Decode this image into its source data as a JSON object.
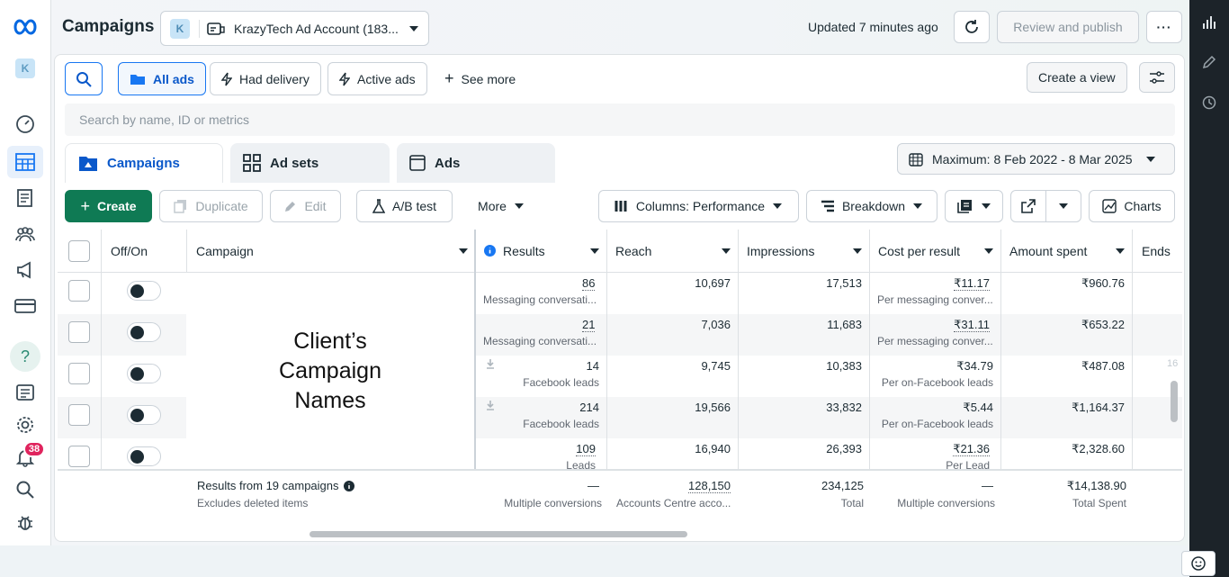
{
  "header": {
    "title": "Campaigns",
    "account_badge": "K",
    "account_name": "KrazyTech Ad Account (183...",
    "updated": "Updated 7 minutes ago",
    "review_publish": "Review and publish"
  },
  "leftnav": {
    "account_badge": "K",
    "notification_count": "38"
  },
  "filters": {
    "all_ads": "All ads",
    "had_delivery": "Had delivery",
    "active_ads": "Active ads",
    "see_more": "See more",
    "create_view": "Create a view"
  },
  "search": {
    "placeholder": "Search by name, ID or metrics"
  },
  "tabs": [
    {
      "label": "Campaigns"
    },
    {
      "label": "Ad sets"
    },
    {
      "label": "Ads"
    }
  ],
  "date_range": "Maximum: 8 Feb 2022 - 8 Mar 2025",
  "toolbar": {
    "create": "Create",
    "duplicate": "Duplicate",
    "edit": "Edit",
    "ab_test": "A/B test",
    "more": "More",
    "columns": "Columns: Performance",
    "breakdown": "Breakdown",
    "charts": "Charts"
  },
  "columns": {
    "offon": "Off/On",
    "campaign": "Campaign",
    "results": "Results",
    "reach": "Reach",
    "impressions": "Impressions",
    "cost": "Cost per result",
    "amount": "Amount spent",
    "ends": "Ends"
  },
  "overlay_text": "Client’s Campaign Names",
  "rows": [
    {
      "results": "86",
      "results_sub": "Messaging conversati...",
      "reach": "10,697",
      "impressions": "17,513",
      "cost": "₹11.17",
      "cost_sub": "Per messaging conver...",
      "amount": "₹960.76"
    },
    {
      "results": "21",
      "results_sub": "Messaging conversati...",
      "reach": "7,036",
      "impressions": "11,683",
      "cost": "₹31.11",
      "cost_sub": "Per messaging conver...",
      "amount": "₹653.22"
    },
    {
      "results": "14",
      "results_sub": "Facebook leads",
      "reach": "9,745",
      "impressions": "10,383",
      "cost": "₹34.79",
      "cost_sub": "Per on-Facebook leads",
      "amount": "₹487.08",
      "ends": "16"
    },
    {
      "results": "214",
      "results_sub": "Facebook leads",
      "reach": "19,566",
      "impressions": "33,832",
      "cost": "₹5.44",
      "cost_sub": "Per on-Facebook leads",
      "amount": "₹1,164.37"
    },
    {
      "results": "109",
      "results_sub": "Leads",
      "reach": "16,940",
      "impressions": "26,393",
      "cost": "₹21.36",
      "cost_sub": "Per Lead",
      "amount": "₹2,328.60"
    }
  ],
  "totals": {
    "label": "Results from 19 campaigns",
    "label_sub": "Excludes deleted items",
    "results": "—",
    "results_sub": "Multiple conversions",
    "reach": "128,150",
    "reach_sub": "Accounts Centre acco...",
    "impressions": "234,125",
    "impressions_sub": "Total",
    "cost": "—",
    "cost_sub": "Multiple conversions",
    "amount": "₹14,138.90",
    "amount_sub": "Total Spent"
  }
}
